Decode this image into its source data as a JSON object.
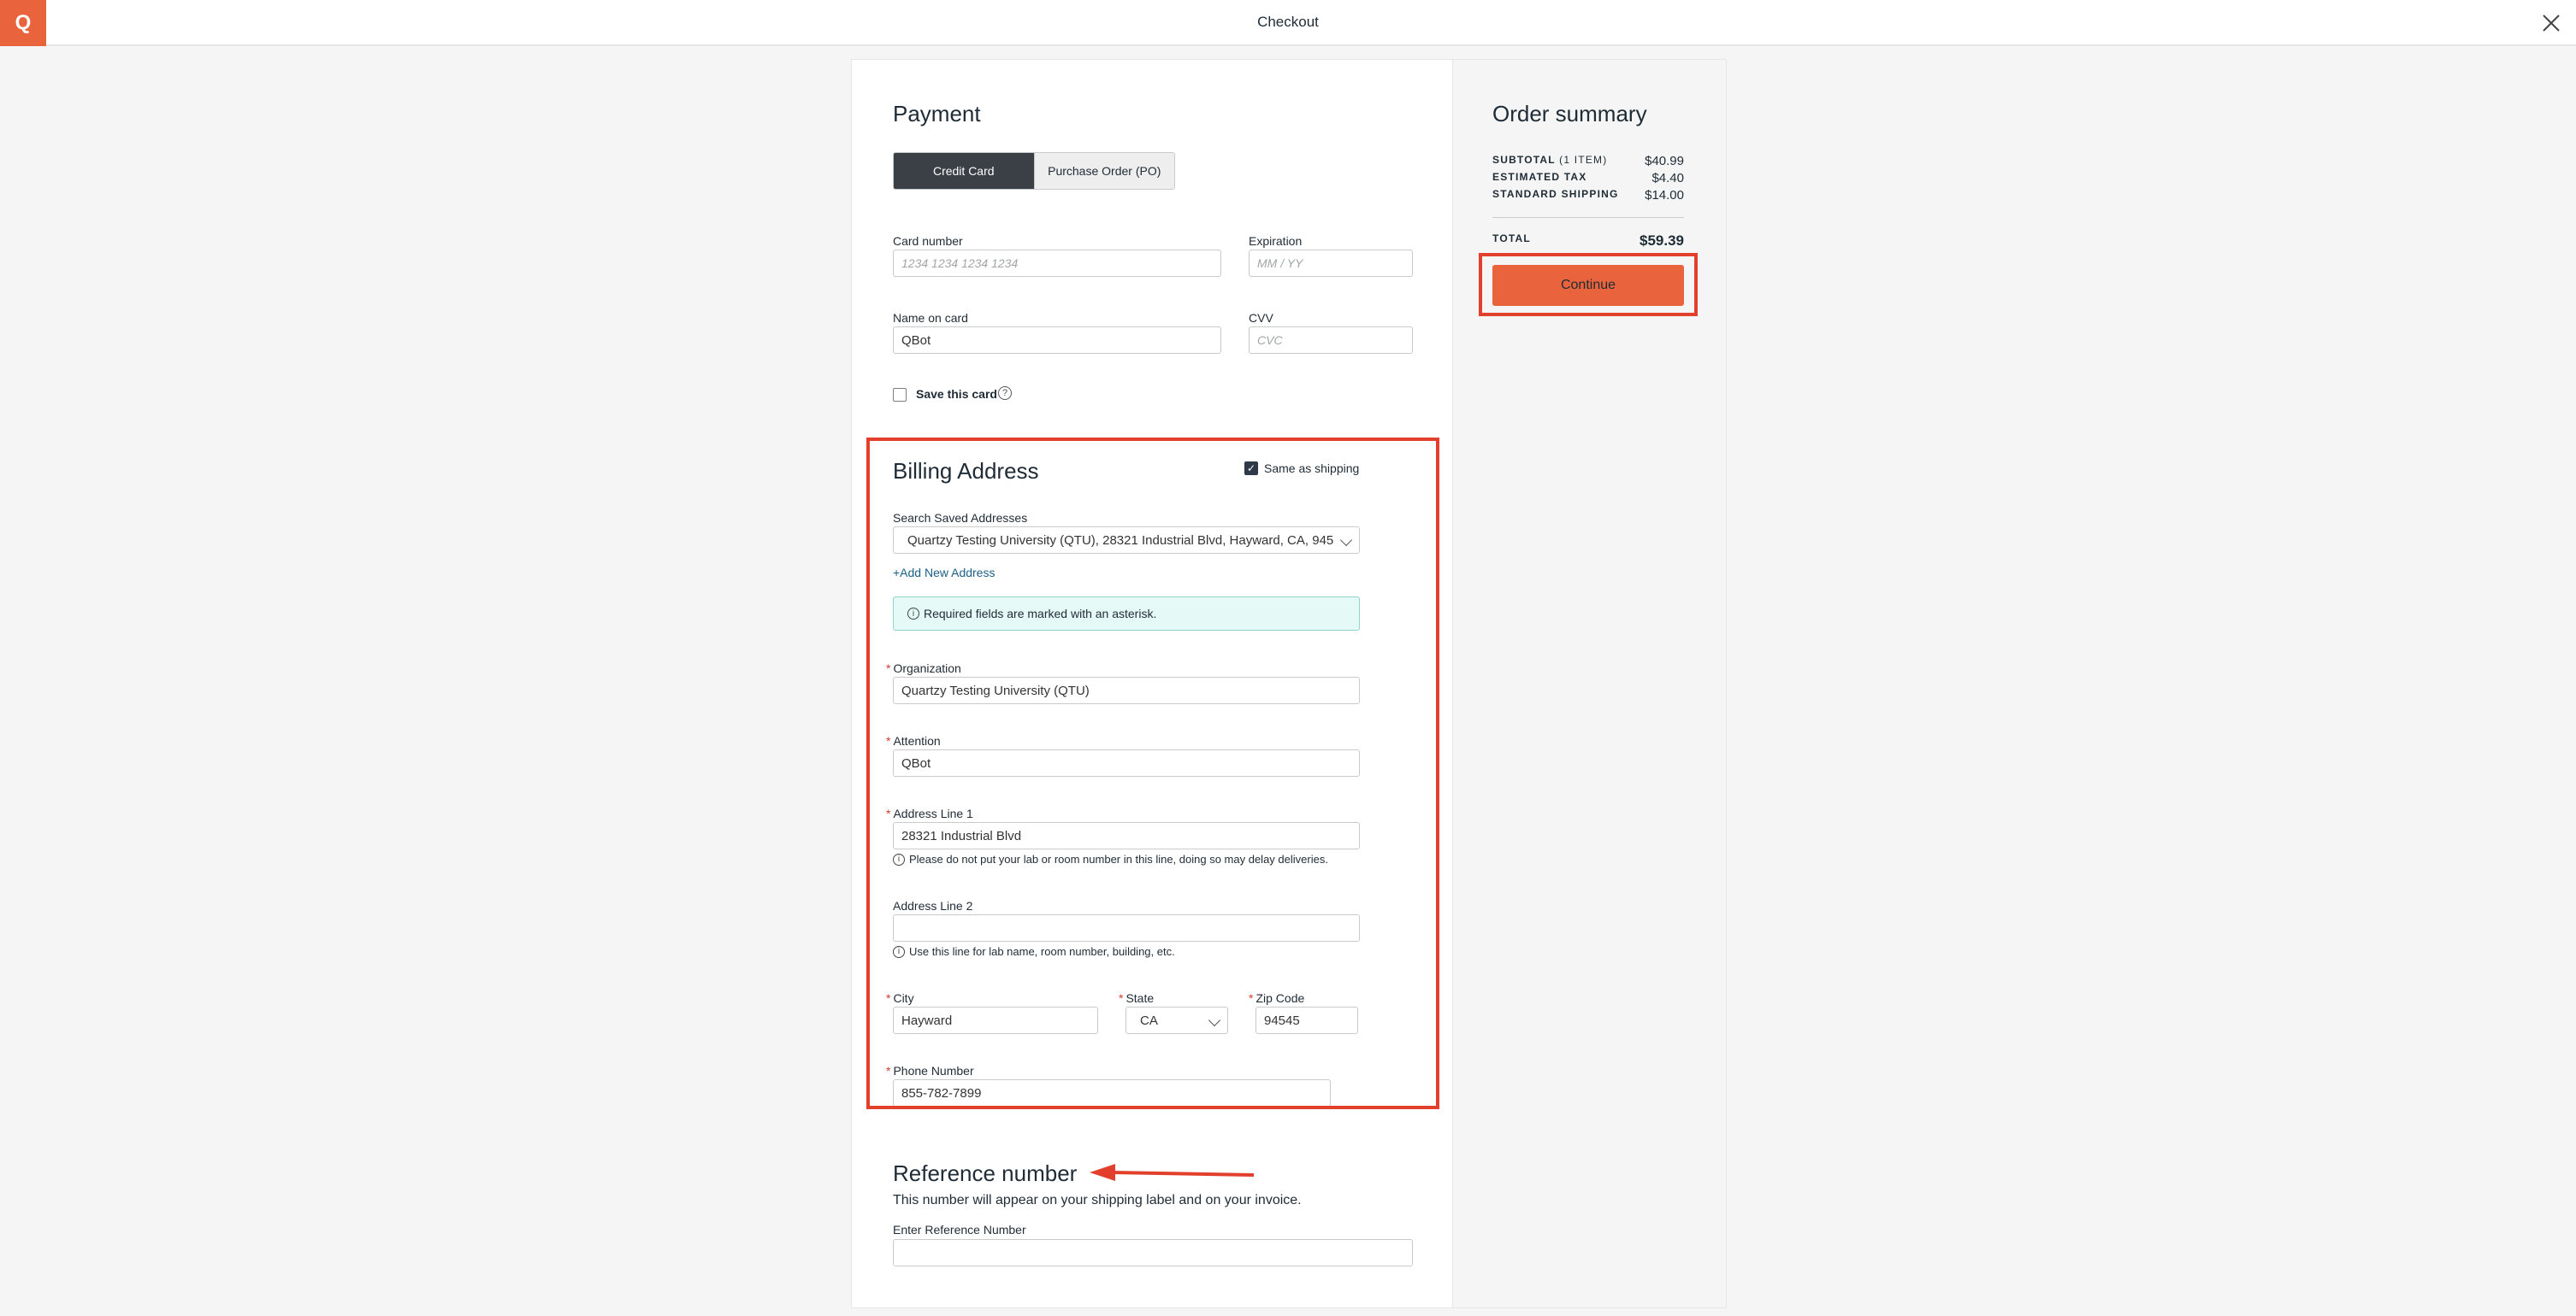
{
  "app": {
    "logo": "Q",
    "title": "Checkout"
  },
  "payment": {
    "heading": "Payment",
    "tabs": [
      "Credit Card",
      "Purchase Order (PO)"
    ],
    "card_number_label": "Card number",
    "card_number_placeholder": "1234 1234 1234 1234",
    "expiration_label": "Expiration",
    "expiration_placeholder": "MM / YY",
    "name_label": "Name on card",
    "name_value": "QBot",
    "cvv_label": "CVV",
    "cvv_placeholder": "CVC",
    "save_card_label": "Save this card",
    "help_glyph": "?"
  },
  "billing": {
    "heading": "Billing Address",
    "same_as_shipping": "Same as shipping",
    "search_label": "Search Saved Addresses",
    "search_value": "Quartzy Testing University (QTU), 28321 Industrial Blvd, Hayward, CA, 945",
    "add_new": "+Add New Address",
    "notice": "Required fields are marked with an asterisk.",
    "required_mark": "*",
    "info_glyph": "i",
    "organization_label": "Organization",
    "organization_value": "Quartzy Testing University (QTU)",
    "attention_label": "Attention",
    "attention_value": "QBot",
    "address1_label": "Address Line 1",
    "address1_value": "28321 Industrial Blvd",
    "address1_hint": "Please do not put your lab or room number in this line, doing so may delay deliveries.",
    "address2_label": "Address Line 2",
    "address2_value": "",
    "address2_hint": "Use this line for lab name, room number, building, etc.",
    "city_label": "City",
    "city_value": "Hayward",
    "state_label": "State",
    "state_value": "CA",
    "zip_label": "Zip Code",
    "zip_value": "94545",
    "phone_label": "Phone Number",
    "phone_value": "855-782-7899"
  },
  "reference": {
    "heading": "Reference number",
    "description": "This number will appear on your shipping label and on your invoice.",
    "field_label": "Enter Reference Number",
    "field_value": ""
  },
  "summary": {
    "heading": "Order summary",
    "subtotal_label": "SUBTOTAL",
    "subtotal_items": "(1 ITEM)",
    "subtotal_value": "$40.99",
    "tax_label": "ESTIMATED TAX",
    "tax_value": "$4.40",
    "shipping_label": "STANDARD SHIPPING",
    "shipping_value": "$14.00",
    "total_label": "TOTAL",
    "total_value": "$59.39",
    "continue_label": "Continue"
  },
  "colors": {
    "accent": "#e9643d",
    "annotation": "#e2402c",
    "notice_bg": "#e5f9f6",
    "active_tab": "#3b4046"
  }
}
